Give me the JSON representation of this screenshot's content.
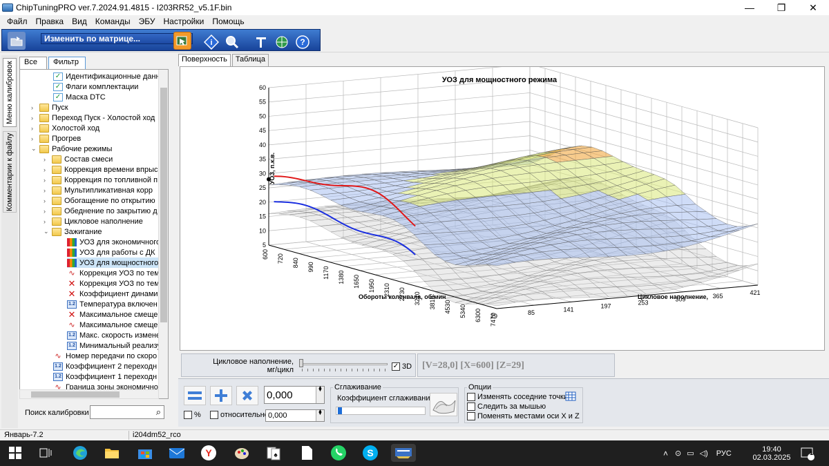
{
  "window": {
    "title": "ChipTuningPRO ver.7.2024.91.4815 - I203RR52_v5.1F.bin",
    "minimize": "—",
    "maximize": "❐",
    "close": "✕"
  },
  "menu": [
    "Файл",
    "Правка",
    "Вид",
    "Команды",
    "ЭБУ",
    "Настройки",
    "Помощь"
  ],
  "toolbar": {
    "mode_combo": "Изменить по матрице..."
  },
  "left": {
    "vertical_tabs": [
      "Меню калибровок",
      "Комментарии к файлу"
    ],
    "tabs": [
      "Все",
      "Фильтр"
    ],
    "tree": [
      {
        "level": 2,
        "expand": "",
        "icon": "check",
        "label": "Идентификационные данные"
      },
      {
        "level": 2,
        "expand": "",
        "icon": "check",
        "label": "Флаги комплектации"
      },
      {
        "level": 2,
        "expand": "",
        "icon": "check",
        "label": "Маска DTC"
      },
      {
        "level": 1,
        "expand": ">",
        "icon": "folder",
        "label": "Пуск"
      },
      {
        "level": 1,
        "expand": ">",
        "icon": "folder",
        "label": "Переход Пуск - Холостой ход"
      },
      {
        "level": 1,
        "expand": ">",
        "icon": "folder",
        "label": "Холостой ход"
      },
      {
        "level": 1,
        "expand": ">",
        "icon": "folder",
        "label": "Прогрев"
      },
      {
        "level": 1,
        "expand": "v",
        "icon": "folder",
        "label": "Рабочие режимы"
      },
      {
        "level": 2,
        "expand": ">",
        "icon": "folder",
        "label": "Состав смеси"
      },
      {
        "level": 2,
        "expand": ">",
        "icon": "folder",
        "label": "Коррекция времени впрыс"
      },
      {
        "level": 2,
        "expand": ">",
        "icon": "folder",
        "label": "Коррекция по топливной п"
      },
      {
        "level": 2,
        "expand": ">",
        "icon": "folder",
        "label": "Мультипликативная корр"
      },
      {
        "level": 2,
        "expand": ">",
        "icon": "folder",
        "label": "Обогащение по открытию"
      },
      {
        "level": 2,
        "expand": ">",
        "icon": "folder",
        "label": "Обеднение по закрытию д"
      },
      {
        "level": 2,
        "expand": ">",
        "icon": "folder",
        "label": "Цикловое наполнение"
      },
      {
        "level": 2,
        "expand": "v",
        "icon": "folder",
        "label": "Зажигание"
      },
      {
        "level": 3,
        "expand": "",
        "icon": "chart3d",
        "label": "УОЗ для экономичного"
      },
      {
        "level": 3,
        "expand": "",
        "icon": "chart3d",
        "label": "УОЗ для работы с ДК"
      },
      {
        "level": 3,
        "expand": "",
        "icon": "chart3d",
        "label": "УОЗ для мощностного",
        "selected": true
      },
      {
        "level": 3,
        "expand": "",
        "icon": "wave",
        "label": "Коррекция УОЗ по тем"
      },
      {
        "level": 3,
        "expand": "",
        "icon": "xmark",
        "label": "Коррекция УОЗ по тем"
      },
      {
        "level": 3,
        "expand": "",
        "icon": "xmark",
        "label": "Коэффициент динамич"
      },
      {
        "level": 3,
        "expand": "",
        "icon": "num",
        "label": "Температура включен"
      },
      {
        "level": 3,
        "expand": "",
        "icon": "xmark",
        "label": "Максимальное смещен"
      },
      {
        "level": 3,
        "expand": "",
        "icon": "wave",
        "label": "Максимальное смещен"
      },
      {
        "level": 3,
        "expand": "",
        "icon": "num",
        "label": "Макс. скорость измене"
      },
      {
        "level": 3,
        "expand": "",
        "icon": "num",
        "label": "Минимальный реализу"
      },
      {
        "level": 2,
        "expand": "",
        "icon": "wave",
        "label": "Номер передачи по скоро"
      },
      {
        "level": 2,
        "expand": "",
        "icon": "num",
        "label": "Коэффициент 2 переходн"
      },
      {
        "level": 2,
        "expand": "",
        "icon": "num",
        "label": "Коэффициент 1 переходн"
      },
      {
        "level": 2,
        "expand": "",
        "icon": "wave",
        "label": "Граница зоны экономично"
      }
    ],
    "search_label": "Поиск калибровки",
    "search_value": ""
  },
  "main": {
    "tabs": [
      "Поверхность",
      "Таблица"
    ],
    "active_tab": 0
  },
  "chart_data": {
    "type": "surface3d",
    "title": "УОЗ для мощностного режима",
    "x_label": "Обороты коленвала, об/мин",
    "z_label": "Цикловое наполнение,",
    "y_label": "УОЗ, п.к.в.",
    "x_ticks": [
      "600",
      "720",
      "840",
      "990",
      "1170",
      "1380",
      "1650",
      "1950",
      "2310",
      "2730",
      "3210",
      "3810",
      "4530",
      "5340",
      "6300",
      "7470"
    ],
    "z_ticks": [
      "29",
      "85",
      "141",
      "197",
      "253",
      "309",
      "365",
      "421"
    ],
    "y_ticks": [
      "5",
      "10",
      "15",
      "20",
      "25",
      "30",
      "35",
      "40",
      "45",
      "50",
      "55",
      "60"
    ],
    "ylim": [
      5,
      60
    ],
    "colors": {
      "top": "#f0a030",
      "mid": "#d8e878",
      "low": "#a8c0f0",
      "red_line": "#e01818",
      "blue_line": "#1a2ee0",
      "grid": "#b8b8b8"
    }
  },
  "controls": {
    "slider_label_1": "Цикловое наполнение,",
    "slider_label_2": "мг/цикл",
    "cb_3d": "3D",
    "cb_3d_checked": "✓",
    "readout": "[V=28,0] [X=600] [Z=29]",
    "value_main": "0,000",
    "value_small": "0,000",
    "cb_percent": "%",
    "cb_relative": "относительно",
    "smoothing_title": "Сглаживание",
    "smoothing_coef": "Коэффициент сглаживания",
    "options_title": "Опции",
    "opt1": "Изменять соседние точки",
    "opt2": "Следить за мышью",
    "opt3": "Поменять местами оси X и Z"
  },
  "status": {
    "left": "Январь-7.2",
    "right": "i204dm52_rco"
  },
  "taskbar": {
    "lang": "РУС",
    "time": "19:40",
    "date": "02.03.2025",
    "notif": "1"
  }
}
